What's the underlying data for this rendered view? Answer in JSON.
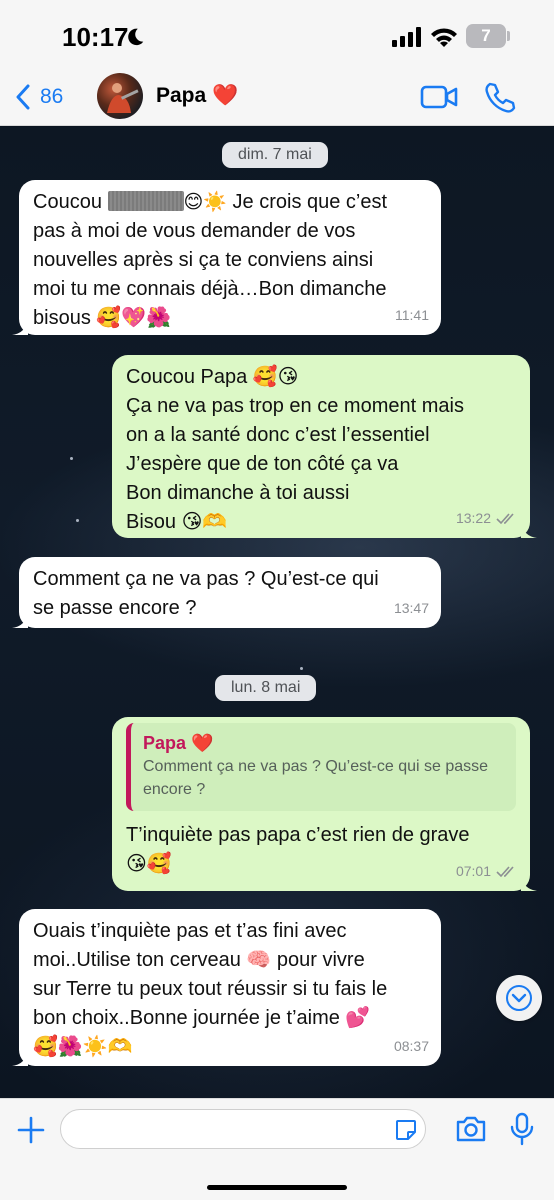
{
  "status_bar": {
    "time": "10:17",
    "battery": "7"
  },
  "header": {
    "back_count": "86",
    "contact_name": "Papa ❤️"
  },
  "dates": {
    "first": "dim. 7 mai",
    "second": "lun. 8 mai"
  },
  "messages": {
    "m1": {
      "lines": [
        "Je crois que c’est",
        "pas à moi de vous demander de vos",
        "nouvelles après si ça te conviens ainsi",
        "moi tu me connais déjà…Bon dimanche",
        "bisous 🥰💖🌺"
      ],
      "prefix": "Coucou",
      "prefix_emoji": "😊☀️",
      "time": "11:41"
    },
    "m2": {
      "lines": [
        "Coucou Papa 🥰😘",
        "Ça ne va pas trop en ce moment mais",
        "on a la santé donc c’est l’essentiel",
        "J’espère que de ton côté ça va",
        "Bon dimanche à toi aussi",
        "Bisou 😘🫶"
      ],
      "time": "13:22"
    },
    "m3": {
      "lines": [
        "Comment ça ne va pas ? Qu’est-ce qui",
        "se passe encore ?"
      ],
      "time": "13:47"
    },
    "m4": {
      "quote_author": "Papa ❤️",
      "quote_lines": [
        "Comment ça ne va pas ? Qu’est-ce qui se passe",
        "encore ?"
      ],
      "lines": [
        "T’inquiète pas papa c’est rien de grave",
        "😘🥰"
      ],
      "time": "07:01"
    },
    "m5": {
      "lines": [
        "Ouais t’inquiète pas et t’as fini avec",
        "moi..Utilise ton cerveau 🧠 pour vivre",
        "sur Terre tu peux tout réussir si tu fais le",
        "bon choix..Bonne journée je t’aime 💕",
        "🥰🌺☀️🫶"
      ],
      "time": "08:37"
    }
  },
  "input": {
    "placeholder": "",
    "value": ""
  },
  "colors": {
    "ios_blue": "#1a7bf2",
    "incoming_bubble": "#ffffff",
    "outgoing_bubble": "#dcf8c6",
    "quote_accent": "#c2185b",
    "chat_background": "#0d1723"
  },
  "icons": {
    "status": [
      "moon-icon",
      "signal-icon",
      "wifi-icon",
      "battery-icon"
    ],
    "header": [
      "chevron-left-icon",
      "video-camera-icon",
      "phone-icon"
    ],
    "input": [
      "plus-icon",
      "sticker-icon",
      "camera-icon",
      "microphone-icon"
    ],
    "chat": [
      "double-check-icon",
      "chevron-down-icon"
    ]
  }
}
